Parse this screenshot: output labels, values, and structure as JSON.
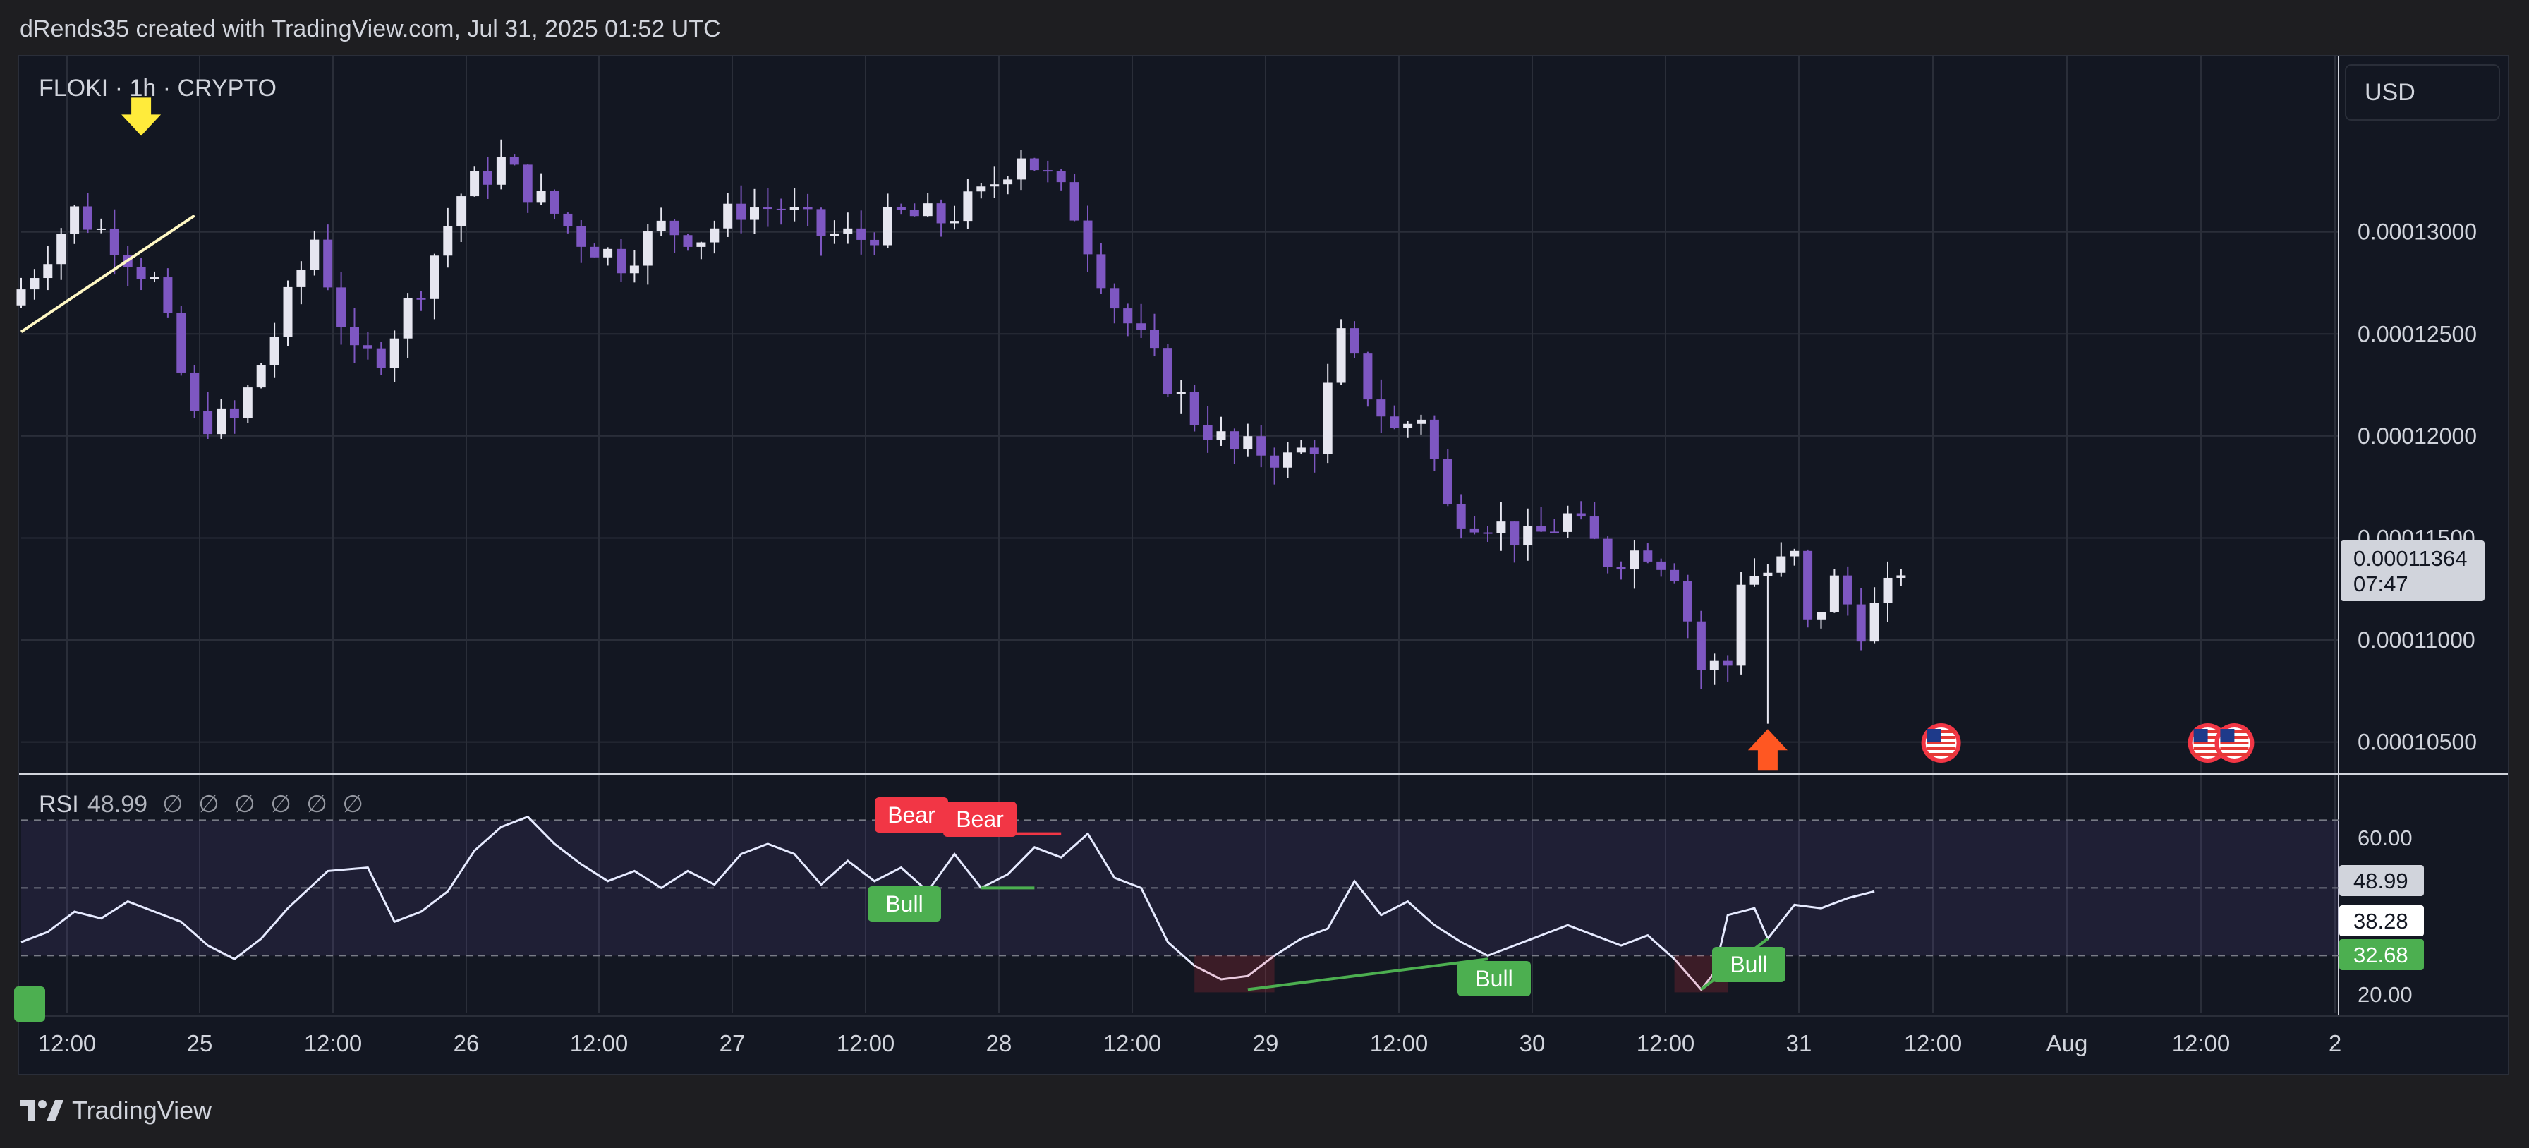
{
  "header": {
    "title": "dRends35 created with TradingView.com, Jul 31, 2025 01:52 UTC"
  },
  "footer": {
    "logo_text": "TradingView"
  },
  "currency_button": "USD",
  "symbol_label": "FLOKI · 1h · CRYPTO",
  "current_price_label": {
    "price": "0.00011364",
    "countdown": "07:47"
  },
  "rsi_legend": {
    "name": "RSI",
    "value": "48.99",
    "placeholders": "∅ ∅ ∅ ∅ ∅ ∅"
  },
  "rsi_scale_labels": {
    "upper": "60.00",
    "lower": "20.00"
  },
  "rsi_value_tags": [
    {
      "text": "48.99",
      "bg": "#d1d4dc",
      "fg": "#131722"
    },
    {
      "text": "38.28",
      "bg": "#ffffff",
      "fg": "#131722"
    },
    {
      "text": "32.68",
      "bg": "#4caf50",
      "fg": "#ffffff"
    }
  ],
  "divergence_labels": {
    "bear": "Bear",
    "bull": "Bull"
  },
  "colors": {
    "up_candle": "#e6e6f0",
    "down_candle": "#7e57c2",
    "trendline": "#fff8c4",
    "down_arrow": "#ffeb3b",
    "up_arrow": "#ff5722",
    "bear": "#f23645",
    "bull": "#4caf50",
    "rsi_line": "#e6eaff",
    "background": "#131722",
    "grid": "#2a2e39"
  },
  "chart_data": [
    {
      "type": "candlestick",
      "title": "FLOKI · 1h · CRYPTO",
      "currency": "USD",
      "ylim": [
        0.0001035,
        0.0001386
      ],
      "y_ticks": [
        "0.00013000",
        "0.00012500",
        "0.00012000",
        "0.00011500",
        "0.00011000",
        "0.00010500"
      ],
      "x_ticks": [
        "12:00",
        "25",
        "12:00",
        "26",
        "12:00",
        "27",
        "12:00",
        "28",
        "12:00",
        "29",
        "12:00",
        "30",
        "12:00",
        "31",
        "12:00",
        "Aug",
        "12:00",
        "2"
      ],
      "last_price": 0.00011364,
      "close_path": [
        [
          0,
          0.0001272
        ],
        [
          4,
          0.000131
        ],
        [
          7,
          0.0001296
        ],
        [
          10,
          0.0001275
        ],
        [
          13,
          0.0001208
        ],
        [
          16,
          0.0001207
        ],
        [
          19,
          0.000125
        ],
        [
          22,
          0.0001297
        ],
        [
          25,
          0.0001237
        ],
        [
          27,
          0.0001241
        ],
        [
          30,
          0.0001275
        ],
        [
          33,
          0.0001318
        ],
        [
          36,
          0.0001334
        ],
        [
          39,
          0.0001315
        ],
        [
          42,
          0.0001297
        ],
        [
          45,
          0.0001286
        ],
        [
          48,
          0.0001302
        ],
        [
          51,
          0.0001298
        ],
        [
          54,
          0.0001312
        ],
        [
          57,
          0.0001312
        ],
        [
          60,
          0.0001299
        ],
        [
          63,
          0.0001297
        ],
        [
          66,
          0.0001308
        ],
        [
          69,
          0.0001306
        ],
        [
          72,
          0.0001317
        ],
        [
          75,
          0.000134
        ],
        [
          77,
          0.0001326
        ],
        [
          79,
          0.000131
        ],
        [
          82,
          0.0001265
        ],
        [
          85,
          0.0001236
        ],
        [
          88,
          0.0001209
        ],
        [
          91,
          0.0001192
        ],
        [
          93,
          0.0001193
        ],
        [
          95,
          0.0001188
        ],
        [
          97,
          0.0001197
        ],
        [
          99,
          0.0001247
        ],
        [
          101,
          0.0001222
        ],
        [
          103,
          0.0001202
        ],
        [
          105,
          0.0001211
        ],
        [
          107,
          0.0001164
        ],
        [
          110,
          0.0001159
        ],
        [
          113,
          0.0001148
        ],
        [
          116,
          0.000116
        ],
        [
          119,
          0.000114
        ],
        [
          122,
          0.0001145
        ],
        [
          124,
          0.0001135
        ],
        [
          126,
          0.0001086
        ],
        [
          128,
          0.0001088
        ],
        [
          129,
          0.0001131
        ],
        [
          131,
          0.0001133
        ],
        [
          133,
          0.000114
        ],
        [
          134,
          0.0001106
        ],
        [
          136,
          0.0001128
        ],
        [
          138,
          0.0001107
        ],
        [
          140,
          0.0001123
        ],
        [
          141,
          0.0001136
        ]
      ],
      "annotations": [
        {
          "type": "down-arrow",
          "x": 9,
          "price": 0.0001352
        },
        {
          "type": "up-arrow",
          "x": 131,
          "price": 0.0001046
        },
        {
          "type": "trendline",
          "from": [
            0,
            0.0001251
          ],
          "to": [
            13,
            0.0001308
          ]
        },
        {
          "type": "event-flag",
          "x": 144
        },
        {
          "type": "event-flag",
          "x": 164
        },
        {
          "type": "event-flag",
          "x": 166
        }
      ]
    },
    {
      "type": "line",
      "title": "RSI",
      "ylim": [
        13,
        83
      ],
      "levels": {
        "upper": 70,
        "middle": 50,
        "lower": 30
      },
      "last_value": 48.99,
      "path": [
        [
          0,
          34
        ],
        [
          2,
          37
        ],
        [
          4,
          43
        ],
        [
          6,
          41
        ],
        [
          8,
          46
        ],
        [
          10,
          43
        ],
        [
          12,
          40
        ],
        [
          14,
          33
        ],
        [
          16,
          29
        ],
        [
          18,
          35
        ],
        [
          20,
          44
        ],
        [
          23,
          55
        ],
        [
          26,
          56
        ],
        [
          28,
          40
        ],
        [
          30,
          43
        ],
        [
          32,
          49
        ],
        [
          34,
          61
        ],
        [
          36,
          68
        ],
        [
          38,
          71
        ],
        [
          40,
          63
        ],
        [
          42,
          57
        ],
        [
          44,
          52
        ],
        [
          46,
          55
        ],
        [
          48,
          50
        ],
        [
          50,
          55
        ],
        [
          52,
          51
        ],
        [
          54,
          60
        ],
        [
          56,
          63
        ],
        [
          58,
          60
        ],
        [
          60,
          51
        ],
        [
          62,
          58
        ],
        [
          64,
          52
        ],
        [
          66,
          56
        ],
        [
          68,
          49
        ],
        [
          70,
          60
        ],
        [
          72,
          50
        ],
        [
          74,
          54
        ],
        [
          76,
          62
        ],
        [
          78,
          59
        ],
        [
          80,
          66
        ],
        [
          82,
          53
        ],
        [
          84,
          50
        ],
        [
          86,
          34
        ],
        [
          88,
          27
        ],
        [
          90,
          23
        ],
        [
          92,
          24
        ],
        [
          94,
          30
        ],
        [
          96,
          35
        ],
        [
          98,
          38
        ],
        [
          100,
          52
        ],
        [
          102,
          42
        ],
        [
          104,
          46
        ],
        [
          106,
          39
        ],
        [
          108,
          34
        ],
        [
          110,
          30
        ],
        [
          112,
          33
        ],
        [
          114,
          36
        ],
        [
          116,
          39
        ],
        [
          118,
          36
        ],
        [
          120,
          33
        ],
        [
          122,
          36
        ],
        [
          124,
          29
        ],
        [
          126,
          20
        ],
        [
          127,
          25
        ],
        [
          128,
          42
        ],
        [
          130,
          44
        ],
        [
          131,
          35
        ],
        [
          133,
          45
        ],
        [
          135,
          44
        ],
        [
          137,
          47
        ],
        [
          139,
          48.99
        ]
      ],
      "divergences": [
        {
          "kind": "bear",
          "from": [
            72,
            66
          ],
          "to": [
            78,
            66
          ]
        },
        {
          "kind": "bull",
          "from": [
            72,
            50
          ],
          "to": [
            76,
            50
          ]
        },
        {
          "kind": "bull",
          "from": [
            92,
            20
          ],
          "to": [
            110,
            29
          ]
        },
        {
          "kind": "bull",
          "from": [
            126,
            20
          ],
          "to": [
            131,
            35
          ]
        }
      ]
    }
  ]
}
